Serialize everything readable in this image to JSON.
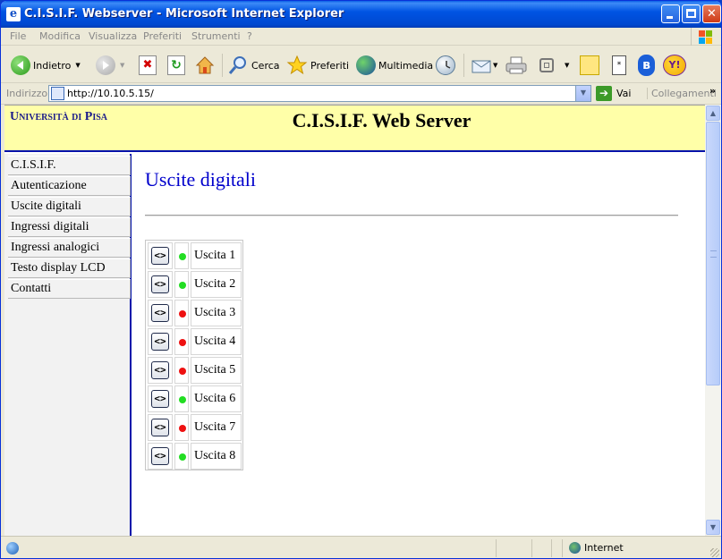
{
  "window": {
    "title": "C.I.S.I.F. Webserver - Microsoft Internet Explorer"
  },
  "menu": [
    "File",
    "Modifica",
    "Visualizza",
    "Preferiti",
    "Strumenti",
    "?"
  ],
  "toolbar": {
    "back": "Indietro",
    "search": "Cerca",
    "favorites": "Preferiti",
    "media": "Multimedia"
  },
  "address": {
    "label": "Indirizzo",
    "url": "http://10.10.5.15/",
    "go": "Vai",
    "links": "Collegamenti",
    "chevron": "»"
  },
  "page": {
    "university": "Università di Pisa",
    "site_title": "C.I.S.I.F. Web Server",
    "heading": "Uscite digitali"
  },
  "sidebar": {
    "items": [
      {
        "label": "C.I.S.I.F."
      },
      {
        "label": "Autenticazione"
      },
      {
        "label": "Uscite digitali"
      },
      {
        "label": "Ingressi digitali"
      },
      {
        "label": "Ingressi analogici"
      },
      {
        "label": "Testo display LCD"
      },
      {
        "label": "Contatti"
      }
    ]
  },
  "outputs": {
    "toggle_label": "<>",
    "rows": [
      {
        "label": "Uscita 1",
        "state": "on"
      },
      {
        "label": "Uscita 2",
        "state": "on"
      },
      {
        "label": "Uscita 3",
        "state": "off"
      },
      {
        "label": "Uscita 4",
        "state": "off"
      },
      {
        "label": "Uscita 5",
        "state": "off"
      },
      {
        "label": "Uscita 6",
        "state": "on"
      },
      {
        "label": "Uscita 7",
        "state": "off"
      },
      {
        "label": "Uscita 8",
        "state": "on"
      }
    ]
  },
  "colors": {
    "on": "#22dd22",
    "off": "#ee1111",
    "header_bg": "#ffffa8",
    "accent": "#0011aa",
    "heading": "#0000cc"
  },
  "status": {
    "zone": "Internet"
  }
}
